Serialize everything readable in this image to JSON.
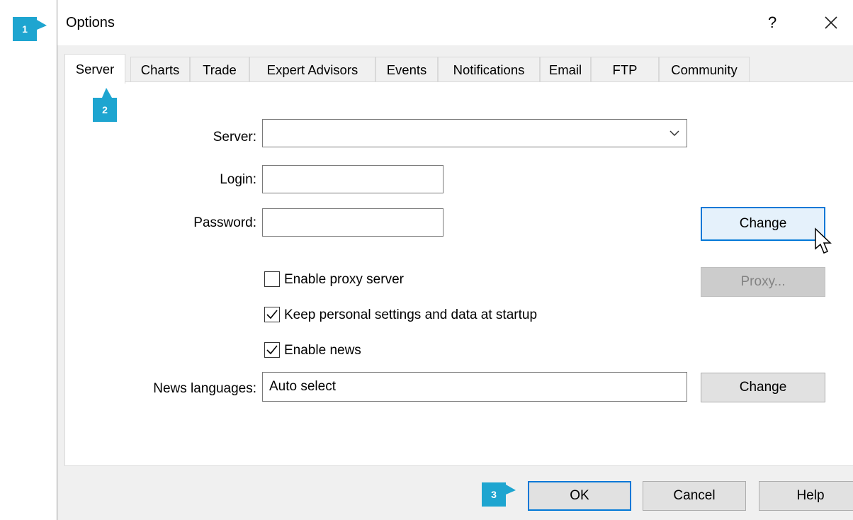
{
  "markers": [
    "1",
    "2",
    "3"
  ],
  "window": {
    "title": "Options",
    "help_glyph": "?",
    "close_icon": "close-icon"
  },
  "tabs": [
    {
      "label": "Server",
      "active": true
    },
    {
      "label": "Charts"
    },
    {
      "label": "Trade"
    },
    {
      "label": "Expert Advisors"
    },
    {
      "label": "Events"
    },
    {
      "label": "Notifications"
    },
    {
      "label": "Email"
    },
    {
      "label": "FTP"
    },
    {
      "label": "Community"
    }
  ],
  "form": {
    "server_label": "Server:",
    "server_value": "",
    "login_label": "Login:",
    "login_value": "",
    "password_label": "Password:",
    "password_value": "",
    "change_password_button": "Change",
    "proxy_checkbox": {
      "label": "Enable proxy server",
      "checked": false
    },
    "proxy_button": "Proxy...",
    "keep_settings_checkbox": {
      "label": "Keep personal settings and data at startup",
      "checked": true
    },
    "news_checkbox": {
      "label": "Enable news",
      "checked": true
    },
    "news_languages_label": "News languages:",
    "news_languages_value": "Auto select",
    "news_languages_button": "Change"
  },
  "footer": {
    "ok": "OK",
    "cancel": "Cancel",
    "help": "Help"
  },
  "colors": {
    "accent": "#0078d7",
    "marker": "#1ea5d0",
    "dialog_bg": "#f0f0f0"
  }
}
